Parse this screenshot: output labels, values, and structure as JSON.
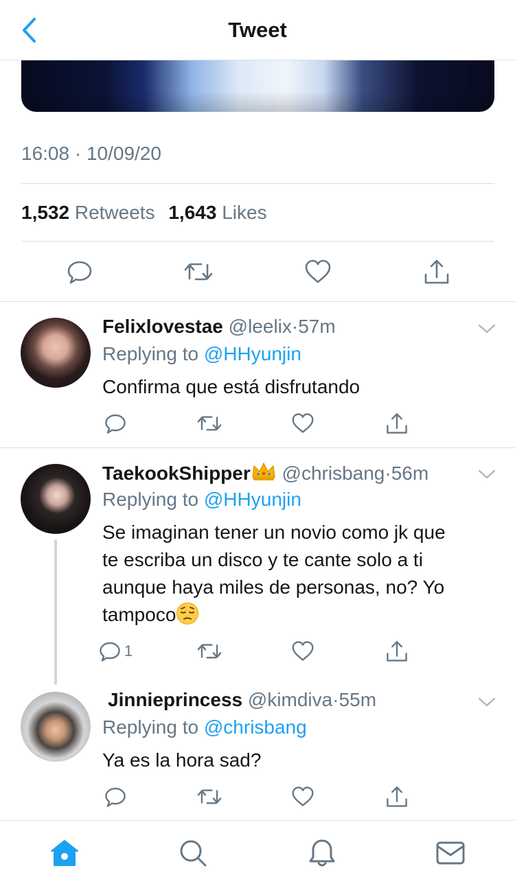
{
  "header": {
    "title": "Tweet",
    "back_icon": "chevron-left-icon",
    "accent_color": "#1da1f2"
  },
  "tweet": {
    "timestamp": "16:08 · 10/09/20",
    "retweets_count": "1,532",
    "retweets_label": "Retweets",
    "likes_count": "1,643",
    "likes_label": "Likes",
    "actions": [
      "reply-icon",
      "retweet-icon",
      "like-icon",
      "share-icon"
    ]
  },
  "replies": [
    {
      "name": "Felixlovestae",
      "handle": "@leelix",
      "dot": "·",
      "time": "57m",
      "replying_prefix": "Replying to",
      "replying_to": "@HHyunjin",
      "text": "Confirma que está disfrutando",
      "reply_count": ""
    },
    {
      "name": "TaekookShipper",
      "name_emoji": "crown-emoji",
      "handle": "@chrisbang",
      "dot": "·",
      "time": "56m",
      "replying_prefix": "Replying to",
      "replying_to": "@HHyunjin",
      "text_lines": [
        "Se imaginan tener un novio como jk que",
        "te escriba un disco y te cante solo a ti",
        "aunque haya miles de personas, no? Yo",
        "tampoco"
      ],
      "text_emoji": "pensive-face-emoji",
      "reply_count": "1"
    },
    {
      "name": "Jinnieprincess",
      "handle": "@kimdiva",
      "dot": "·",
      "time": "55m",
      "replying_prefix": "Replying to",
      "replying_to": "@chrisbang",
      "text": "Ya es la hora sad?",
      "reply_count": ""
    }
  ],
  "tabbar": {
    "items": [
      "home-icon",
      "search-icon",
      "notifications-icon",
      "messages-icon"
    ],
    "active": "home-icon"
  }
}
